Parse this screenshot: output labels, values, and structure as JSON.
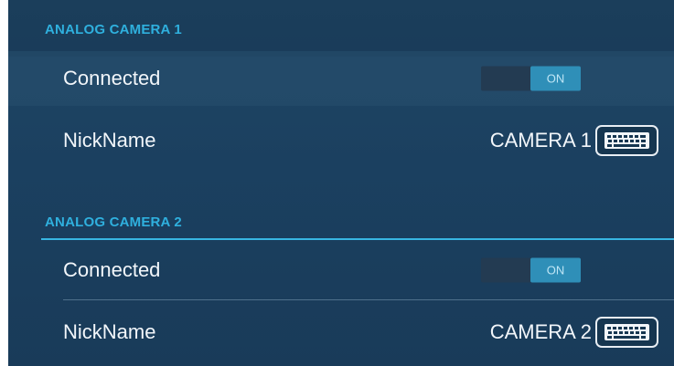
{
  "camera1": {
    "header": "ANALOG CAMERA 1",
    "connected_label": "Connected",
    "connected_state": "ON",
    "nickname_label": "NickName",
    "nickname_value": "CAMERA 1",
    "keyboard_icon": "keyboard-icon"
  },
  "camera2": {
    "header": "ANALOG CAMERA 2",
    "connected_label": "Connected",
    "connected_state": "ON",
    "nickname_label": "NickName",
    "nickname_value": "CAMERA 2",
    "keyboard_icon": "keyboard-icon"
  },
  "colors": {
    "accent": "#2fb0de",
    "toggle_on": "#2f8fb8",
    "background": "#1d4262"
  }
}
